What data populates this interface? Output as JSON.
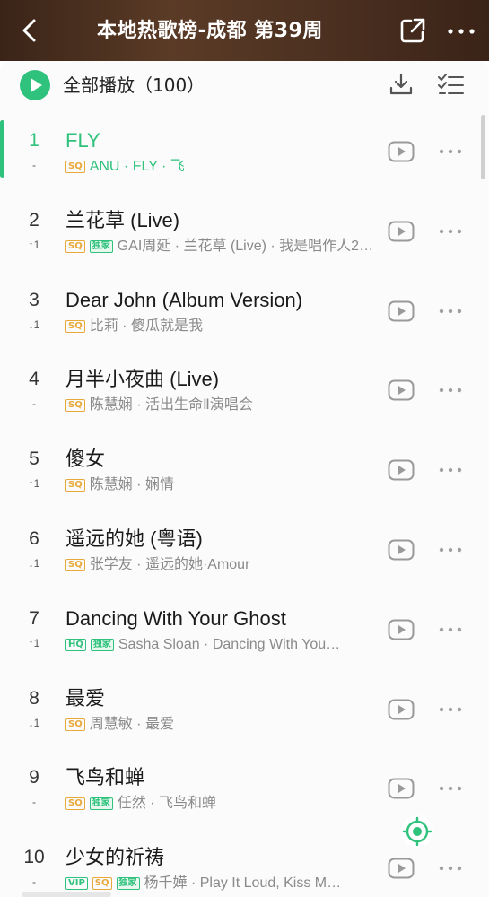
{
  "header": {
    "title": "本地热歌榜-成都 第39周"
  },
  "toolbar": {
    "play_all_label": "全部播放（100）"
  },
  "songs": [
    {
      "rank": "1",
      "trend": "-",
      "title": "FLY",
      "badges": [
        "SQ"
      ],
      "artist": "ANU",
      "album": "FLY · 飞",
      "active": true
    },
    {
      "rank": "2",
      "trend": "↑1",
      "title": "兰花草 (Live)",
      "badges": [
        "SQ",
        "独家"
      ],
      "artist": "GAI周延",
      "album": "兰花草 (Live) · 我是唱作人2…"
    },
    {
      "rank": "3",
      "trend": "↓1",
      "title": "Dear John (Album Version)",
      "badges": [
        "SQ"
      ],
      "artist": "比莉",
      "album": "傻瓜就是我"
    },
    {
      "rank": "4",
      "trend": "-",
      "title": "月半小夜曲 (Live)",
      "badges": [
        "SQ"
      ],
      "artist": "陈慧娴",
      "album": "活出生命Ⅱ演唱会"
    },
    {
      "rank": "5",
      "trend": "↑1",
      "title": "傻女",
      "badges": [
        "SQ"
      ],
      "artist": "陈慧娴",
      "album": "娴情"
    },
    {
      "rank": "6",
      "trend": "↓1",
      "title": "遥远的她 (粤语)",
      "badges": [
        "SQ"
      ],
      "artist": "张学友",
      "album": "遥远的她·Amour"
    },
    {
      "rank": "7",
      "trend": "↑1",
      "title": "Dancing With Your Ghost",
      "badges": [
        "HQ",
        "独家"
      ],
      "artist": "Sasha Sloan",
      "album": "Dancing With You…"
    },
    {
      "rank": "8",
      "trend": "↓1",
      "title": "最爱",
      "badges": [
        "SQ"
      ],
      "artist": "周慧敏",
      "album": "最爱"
    },
    {
      "rank": "9",
      "trend": "-",
      "title": "飞鸟和蝉",
      "badges": [
        "SQ",
        "独家"
      ],
      "artist": "任然",
      "album": "飞鸟和蝉"
    },
    {
      "rank": "10",
      "trend": "-",
      "title": "少女的祈祷",
      "badges": [
        "VIP",
        "SQ",
        "独家"
      ],
      "artist": "杨千嬅",
      "album": "Play It Loud, Kiss M…"
    }
  ],
  "icons": {
    "back": "back-arrow-icon",
    "share": "share-icon",
    "more": "more-icon",
    "play_all": "play-circle-icon",
    "download": "download-icon",
    "multi_select": "multi-select-icon",
    "row_play": "play-video-icon",
    "row_more": "more-dots-icon",
    "locate": "locate-current-icon"
  },
  "colors": {
    "accent": "#2fc27c",
    "sq_badge": "#e8a93a",
    "header_bg": "#4a2f20"
  }
}
